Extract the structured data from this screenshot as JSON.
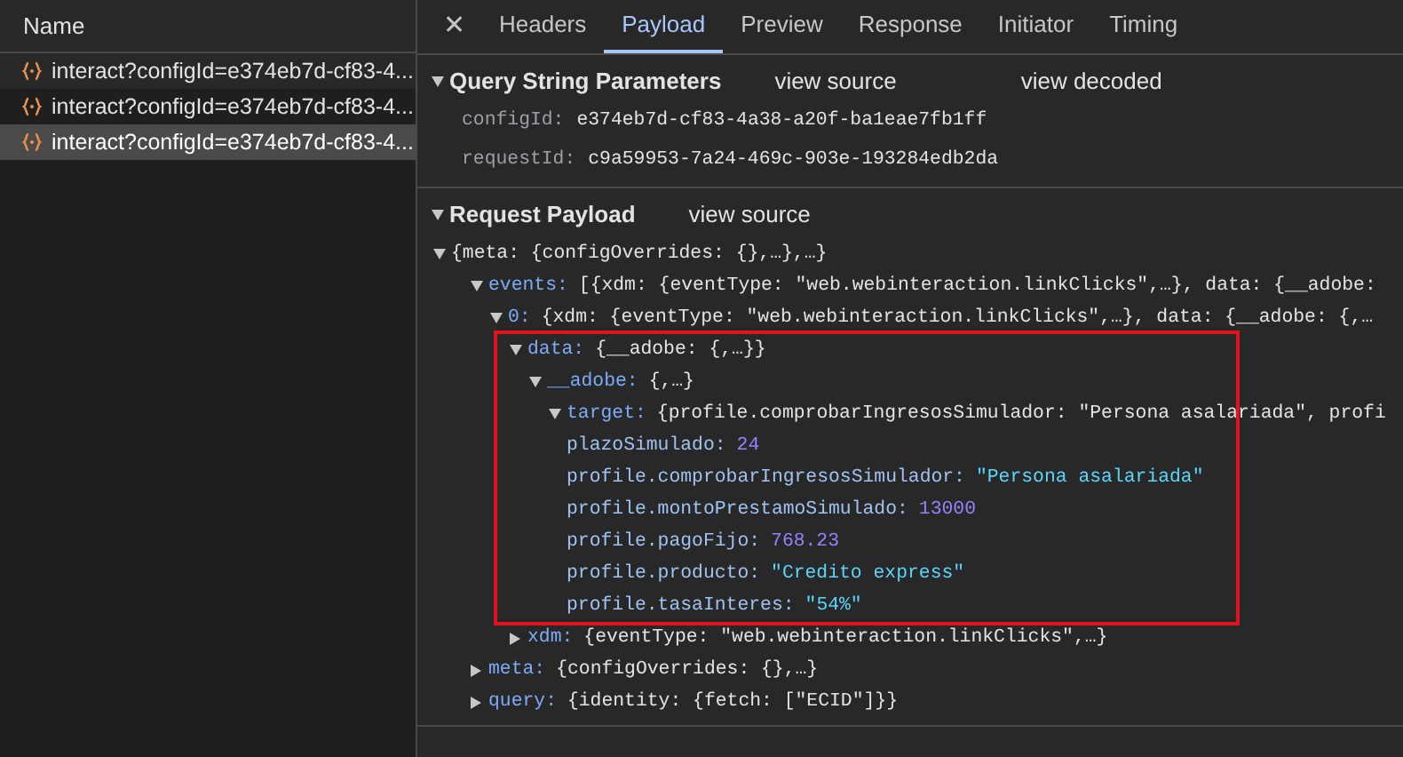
{
  "sidebar": {
    "header": "Name",
    "requests": [
      {
        "name": "interact?configId=e374eb7d-cf83-4...",
        "selected": false
      },
      {
        "name": "interact?configId=e374eb7d-cf83-4...",
        "selected": false
      },
      {
        "name": "interact?configId=e374eb7d-cf83-4...",
        "selected": true
      }
    ]
  },
  "close_symbol": "✕",
  "tabs": [
    {
      "label": "Headers",
      "selected": false
    },
    {
      "label": "Payload",
      "selected": true
    },
    {
      "label": "Preview",
      "selected": false
    },
    {
      "label": "Response",
      "selected": false
    },
    {
      "label": "Initiator",
      "selected": false
    },
    {
      "label": "Timing",
      "selected": false
    }
  ],
  "query_string": {
    "title": "Query String Parameters",
    "expanded": true,
    "links": [
      "view source",
      "view decoded"
    ],
    "params": [
      {
        "key": "configId:",
        "value": "e374eb7d-cf83-4a38-a20f-ba1eae7fb1ff"
      },
      {
        "key": "requestId:",
        "value": "c9a59953-7a24-469c-903e-193284edb2da"
      }
    ]
  },
  "request_payload": {
    "title": "Request Payload",
    "expanded": true,
    "links": [
      "view source"
    ],
    "tree": [
      {
        "summary": "{meta: {configOverrides: {},…},…}",
        "expanded": true,
        "children": [
          {
            "key": "events:",
            "summary": "[{xdm: {eventType: \"web.webinteraction.linkClicks\",…}, data: {__adobe:",
            "expanded": true,
            "children": [
              {
                "key": "0:",
                "summary": "{xdm: {eventType: \"web.webinteraction.linkClicks\",…}, data: {__adobe: {,…",
                "expanded": true,
                "children": [
                  {
                    "key": "data:",
                    "summary": "{__adobe: {,…}}",
                    "expanded": true,
                    "highlighted": true,
                    "children": [
                      {
                        "key": "__adobe:",
                        "summary": "{,…}",
                        "expanded": true,
                        "children": [
                          {
                            "key": "target:",
                            "summary": "{profile.comprobarIngresosSimulador: \"Persona asalariada\", profi",
                            "expanded": true,
                            "children": [
                              {
                                "key": "plazoSimulado:",
                                "value": "24",
                                "kind": "number"
                              },
                              {
                                "key": "profile.comprobarIngresosSimulador:",
                                "value": "\"Persona asalariada\"",
                                "kind": "string"
                              },
                              {
                                "key": "profile.montoPrestamoSimulado:",
                                "value": "13000",
                                "kind": "number"
                              },
                              {
                                "key": "profile.pagoFijo:",
                                "value": "768.23",
                                "kind": "number"
                              },
                              {
                                "key": "profile.producto:",
                                "value": "\"Credito express\"",
                                "kind": "string"
                              },
                              {
                                "key": "profile.tasaInteres:",
                                "value": "\"54%\"",
                                "kind": "string"
                              }
                            ]
                          }
                        ]
                      }
                    ]
                  },
                  {
                    "key": "xdm:",
                    "summary": "{eventType: \"web.webinteraction.linkClicks\",…}",
                    "expanded": false
                  }
                ]
              }
            ]
          },
          {
            "key": "meta:",
            "summary": "{configOverrides: {},…}",
            "expanded": false
          },
          {
            "key": "query:",
            "summary": "{identity: {fetch: [\"ECID\"]}}",
            "expanded": false
          }
        ]
      }
    ]
  }
}
